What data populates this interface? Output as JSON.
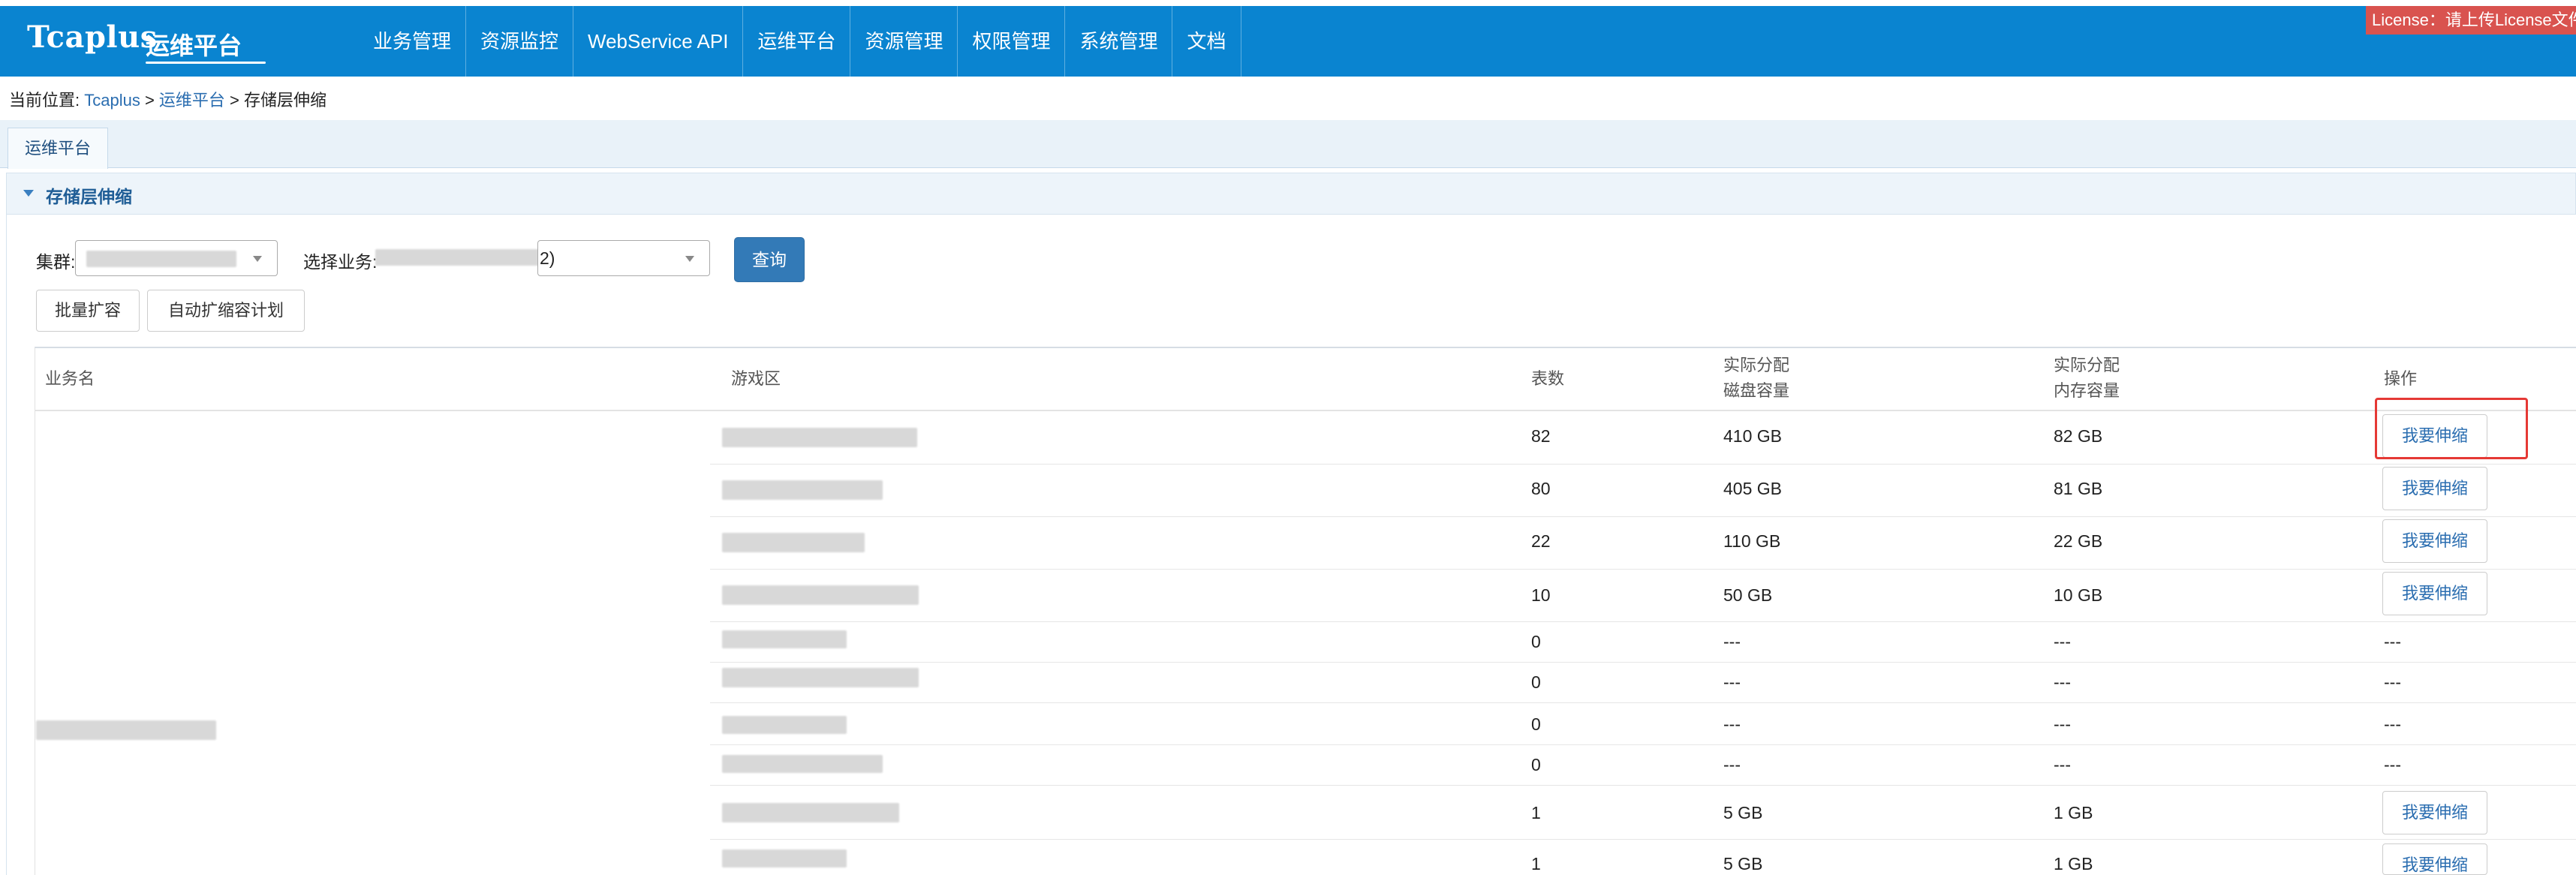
{
  "header": {
    "logo_main": "Tcaplus",
    "logo_sub": "运维平台",
    "nav": [
      "业务管理",
      "资源监控",
      "WebService API",
      "运维平台",
      "资源管理",
      "权限管理",
      "系统管理",
      "文档"
    ],
    "license_text": "License：请上传License文件"
  },
  "breadcrumb": {
    "prefix": "当前位置: ",
    "home": "Tcaplus",
    "sep1": " > ",
    "parent": "运维平台",
    "sep2": " > ",
    "current": "存储层伸缩"
  },
  "tabs": [
    {
      "label": "运维平台"
    }
  ],
  "panel": {
    "title": "存储层伸缩"
  },
  "form": {
    "cluster_label": "集群:",
    "business_label": "选择业务:",
    "business_suffix": "2)",
    "query_button": "查询",
    "batch_expand_button": "批量扩容",
    "auto_plan_button": "自动扩缩容计划"
  },
  "table": {
    "headers": {
      "business": "业务名",
      "zone": "游戏区",
      "tables": "表数",
      "disk_1": "实际分配",
      "disk_2": "磁盘容量",
      "mem_1": "实际分配",
      "mem_2": "内存容量",
      "op": "操作"
    },
    "rows": [
      {
        "tables": "82",
        "disk": "410 GB",
        "mem": "82 GB",
        "op": "我要伸缩"
      },
      {
        "tables": "80",
        "disk": "405 GB",
        "mem": "81 GB",
        "op": "我要伸缩"
      },
      {
        "tables": "22",
        "disk": "110 GB",
        "mem": "22 GB",
        "op": "我要伸缩"
      },
      {
        "tables": "10",
        "disk": "50 GB",
        "mem": "10 GB",
        "op": "我要伸缩"
      },
      {
        "tables": "0",
        "disk": "---",
        "mem": "---",
        "op": "---"
      },
      {
        "tables": "0",
        "disk": "---",
        "mem": "---",
        "op": "---"
      },
      {
        "tables": "0",
        "disk": "---",
        "mem": "---",
        "op": "---"
      },
      {
        "tables": "0",
        "disk": "---",
        "mem": "---",
        "op": "---"
      },
      {
        "tables": "1",
        "disk": "5 GB",
        "mem": "1 GB",
        "op": "我要伸缩"
      },
      {
        "tables": "1",
        "disk": "5 GB",
        "mem": "1 GB",
        "op": "我要伸缩"
      }
    ]
  },
  "colors": {
    "nav_bg": "#0a84d0",
    "primary": "#337ab7",
    "license_bg": "#d9534f",
    "highlight": "#e53935"
  }
}
